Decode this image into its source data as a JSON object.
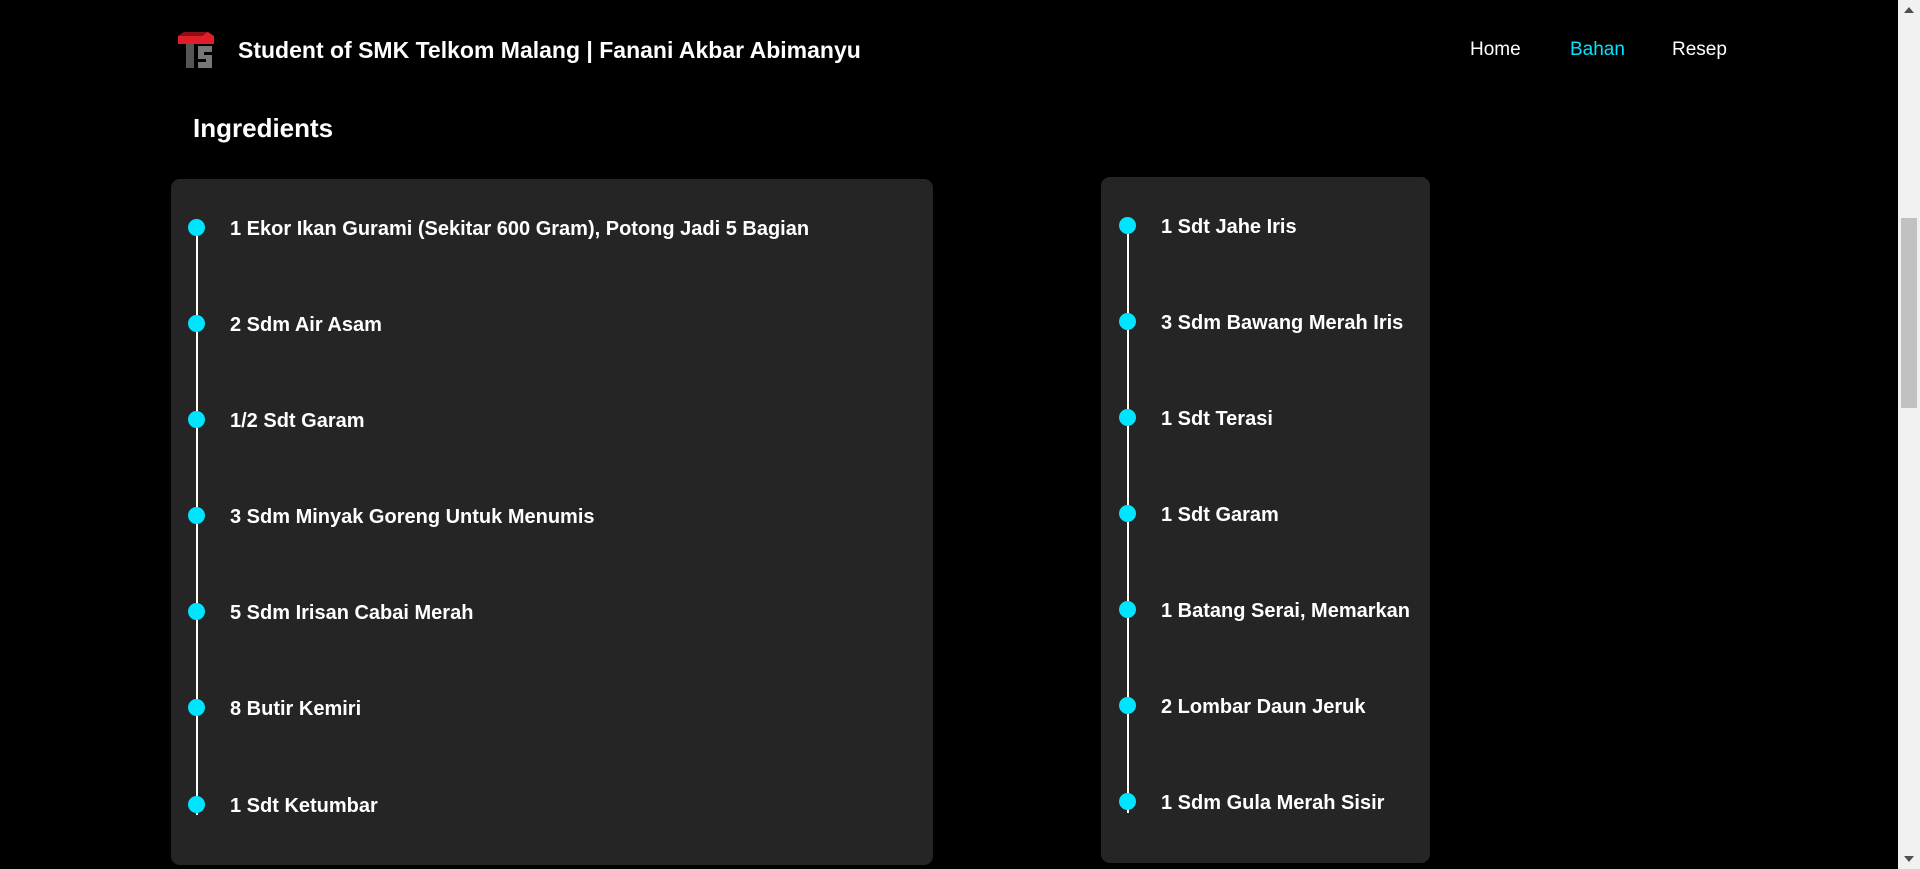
{
  "navbar": {
    "brand": "Student of SMK Telkom Malang | Fanani Akbar Abimanyu",
    "logo_icon": "telkom-schools-logo-icon",
    "links": [
      {
        "label": "Home",
        "active": false
      },
      {
        "label": "Bahan",
        "active": true
      },
      {
        "label": "Resep",
        "active": false
      }
    ]
  },
  "section": {
    "title": "Ingredients"
  },
  "ingredients_left": [
    "1 Ekor Ikan Gurami (Sekitar 600 Gram), Potong Jadi 5 Bagian",
    "2 Sdm Air Asam",
    "1/2 Sdt Garam",
    "3 Sdm Minyak Goreng Untuk Menumis",
    "5 Sdm Irisan Cabai Merah",
    "8 Butir Kemiri",
    "1 Sdt Ketumbar"
  ],
  "ingredients_right": [
    "1 Sdt Jahe Iris",
    "3 Sdm Bawang Merah Iris",
    "1 Sdt Terasi",
    "1 Sdt Garam",
    "1 Batang Serai, Memarkan",
    "2 Lombar Daun Jeruk",
    "1 Sdm Gula Merah Sisir"
  ],
  "colors": {
    "background": "#000000",
    "card": "#252525",
    "accent": "#00e5ff",
    "text": "#ffffff"
  }
}
